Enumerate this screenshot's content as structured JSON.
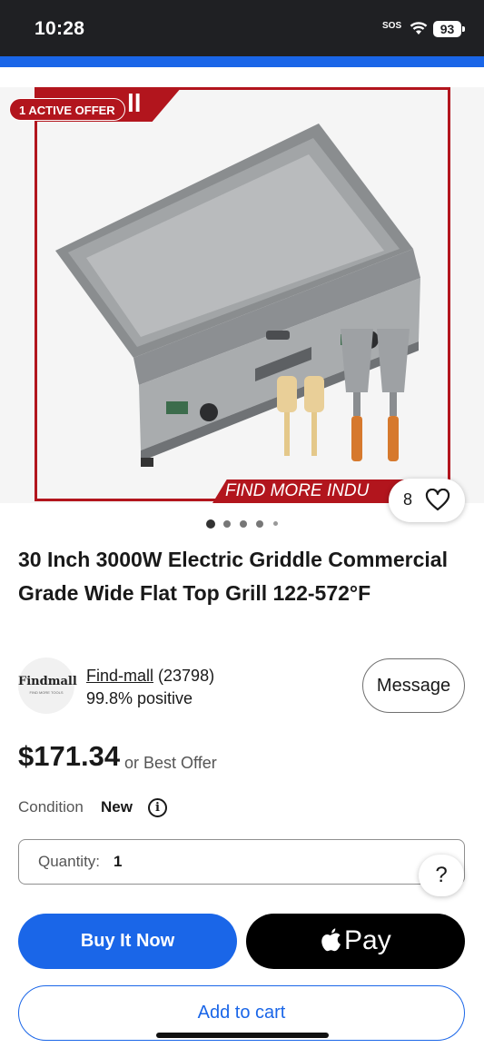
{
  "status_bar": {
    "time": "10:28",
    "sos": "SOS",
    "battery": "93"
  },
  "gallery": {
    "offer_badge": "1 ACTIVE OFFER",
    "banner_top_text": "ll",
    "banner_bottom_text": "FIND MORE INDU",
    "watch_count": "8"
  },
  "product": {
    "title": "30 Inch 3000W Electric Griddle Commercial Grade Wide Flat Top Grill 122-572°F"
  },
  "seller": {
    "logo_text": "Findmall",
    "logo_subtext": "FIND MORE TOOLS",
    "name": "Find-mall",
    "rating_count": "(23798)",
    "feedback": "99.8% positive",
    "message_label": "Message"
  },
  "price": {
    "amount": "$171.34",
    "note": "or Best Offer"
  },
  "condition": {
    "label": "Condition",
    "value": "New",
    "info_icon": "i"
  },
  "quantity": {
    "label": "Quantity:",
    "value": "1",
    "help": "?"
  },
  "actions": {
    "buy_now": "Buy It Now",
    "apple_pay": "Pay",
    "add_to_cart": "Add to cart"
  },
  "colors": {
    "accent": "#1a66e8",
    "brand_red": "#b2151d",
    "status_bar": "#1f2023"
  }
}
